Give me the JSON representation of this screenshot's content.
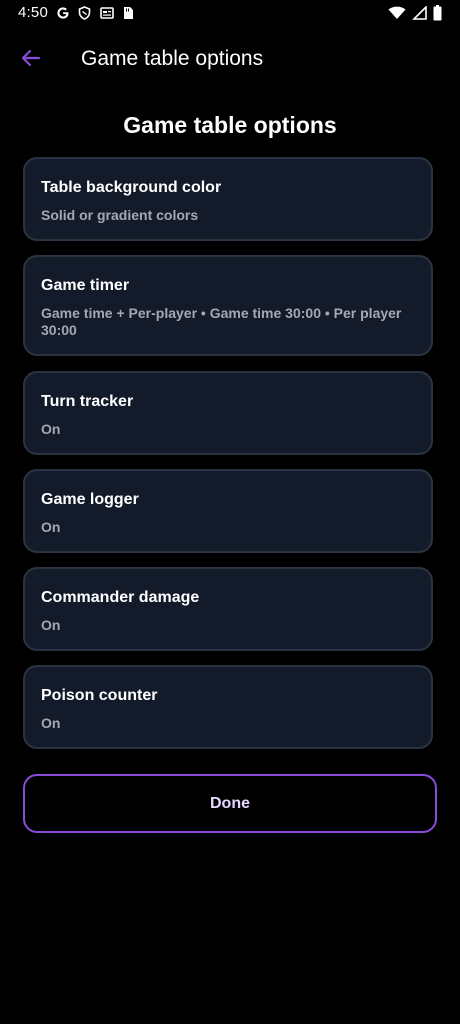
{
  "status_bar": {
    "time": "4:50",
    "left_icons": [
      "google-g-icon",
      "shield-icon",
      "news-icon",
      "sim-card-icon"
    ],
    "right_icons": [
      "wifi-icon",
      "cell-signal-icon",
      "battery-icon"
    ]
  },
  "app_bar": {
    "back_icon": "arrow-left-icon",
    "title": "Game table options"
  },
  "page": {
    "heading": "Game table options"
  },
  "options": [
    {
      "title": "Table background color",
      "subtitle": "Solid or gradient colors"
    },
    {
      "title": "Game timer",
      "subtitle": "Game time + Per-player • Game time 30:00 • Per player 30:00"
    },
    {
      "title": "Turn tracker",
      "subtitle": "On"
    },
    {
      "title": "Game logger",
      "subtitle": "On"
    },
    {
      "title": "Commander damage",
      "subtitle": "On"
    },
    {
      "title": "Poison counter",
      "subtitle": "On"
    }
  ],
  "done_button": {
    "label": "Done"
  },
  "colors": {
    "background": "#000000",
    "card": "#131b2b",
    "card_border": "#2b3240",
    "accent": "#8b4bd9",
    "subtitle": "#a3a8b3"
  }
}
